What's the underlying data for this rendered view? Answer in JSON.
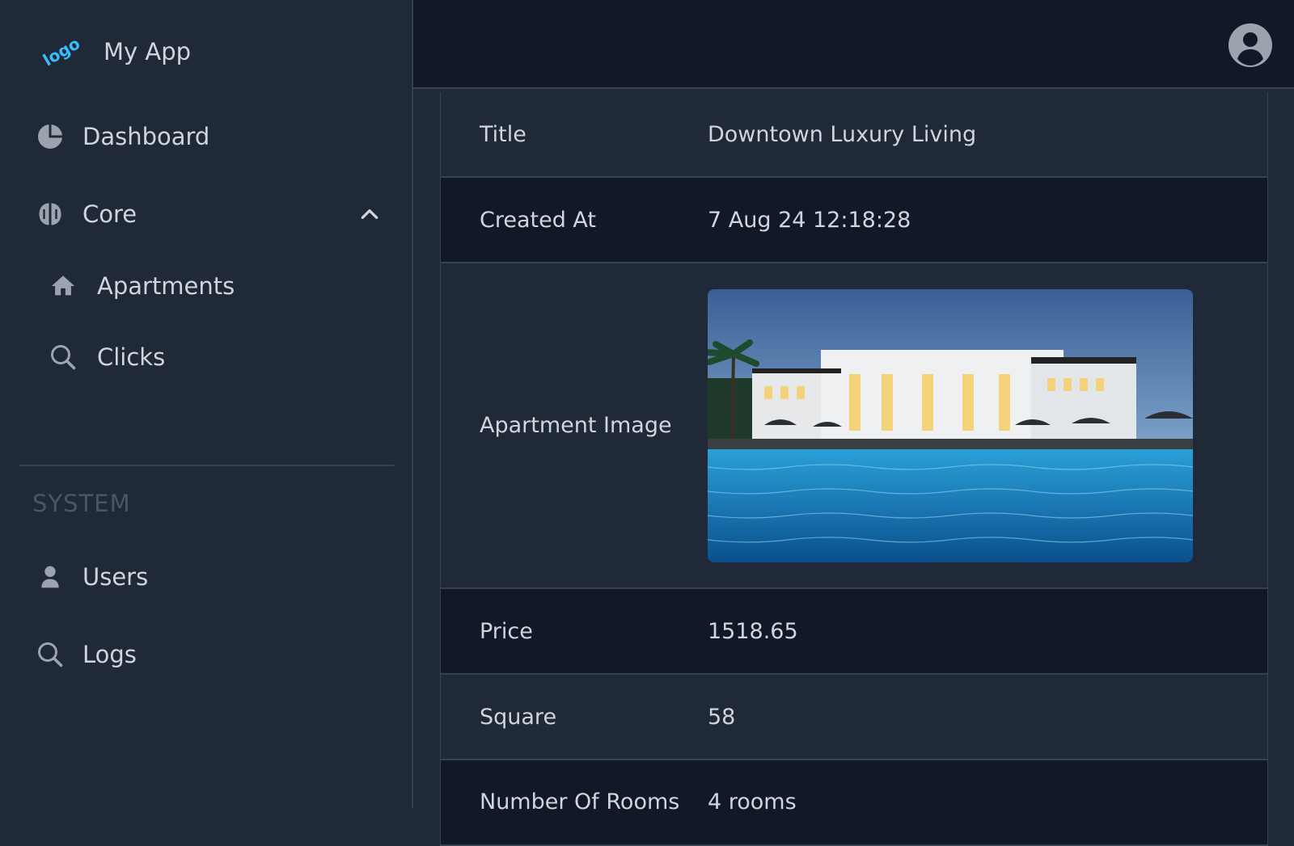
{
  "app": {
    "logo_text": "logo",
    "name": "My App"
  },
  "sidebar": {
    "dashboard": {
      "label": "Dashboard",
      "icon": "pie-chart-icon"
    },
    "core": {
      "label": "Core",
      "icon": "brain-icon",
      "expanded": true
    },
    "core_items": [
      {
        "label": "Apartments",
        "icon": "home-icon"
      },
      {
        "label": "Clicks",
        "icon": "search-icon"
      }
    ],
    "section_title": "SYSTEM",
    "system_items": [
      {
        "label": "Users",
        "icon": "user-icon"
      },
      {
        "label": "Logs",
        "icon": "search-icon"
      }
    ]
  },
  "header": {
    "avatar_icon": "user-circle-icon"
  },
  "details": {
    "rows": [
      {
        "label": "Title",
        "value": "Downtown Luxury Living"
      },
      {
        "label": "Created At",
        "value": "7 Aug 24 12:18:28"
      },
      {
        "label": "Apartment Image",
        "value": ""
      },
      {
        "label": "Price",
        "value": "1518.65"
      },
      {
        "label": "Square",
        "value": "58"
      },
      {
        "label": "Number Of Rooms",
        "value": "4 rooms"
      }
    ]
  },
  "colors": {
    "sidebar_bg": "#1f2937",
    "topbar_bg": "#111827",
    "accent": "#38bdf8",
    "text": "#d1d5db",
    "muted": "#4b5563"
  }
}
